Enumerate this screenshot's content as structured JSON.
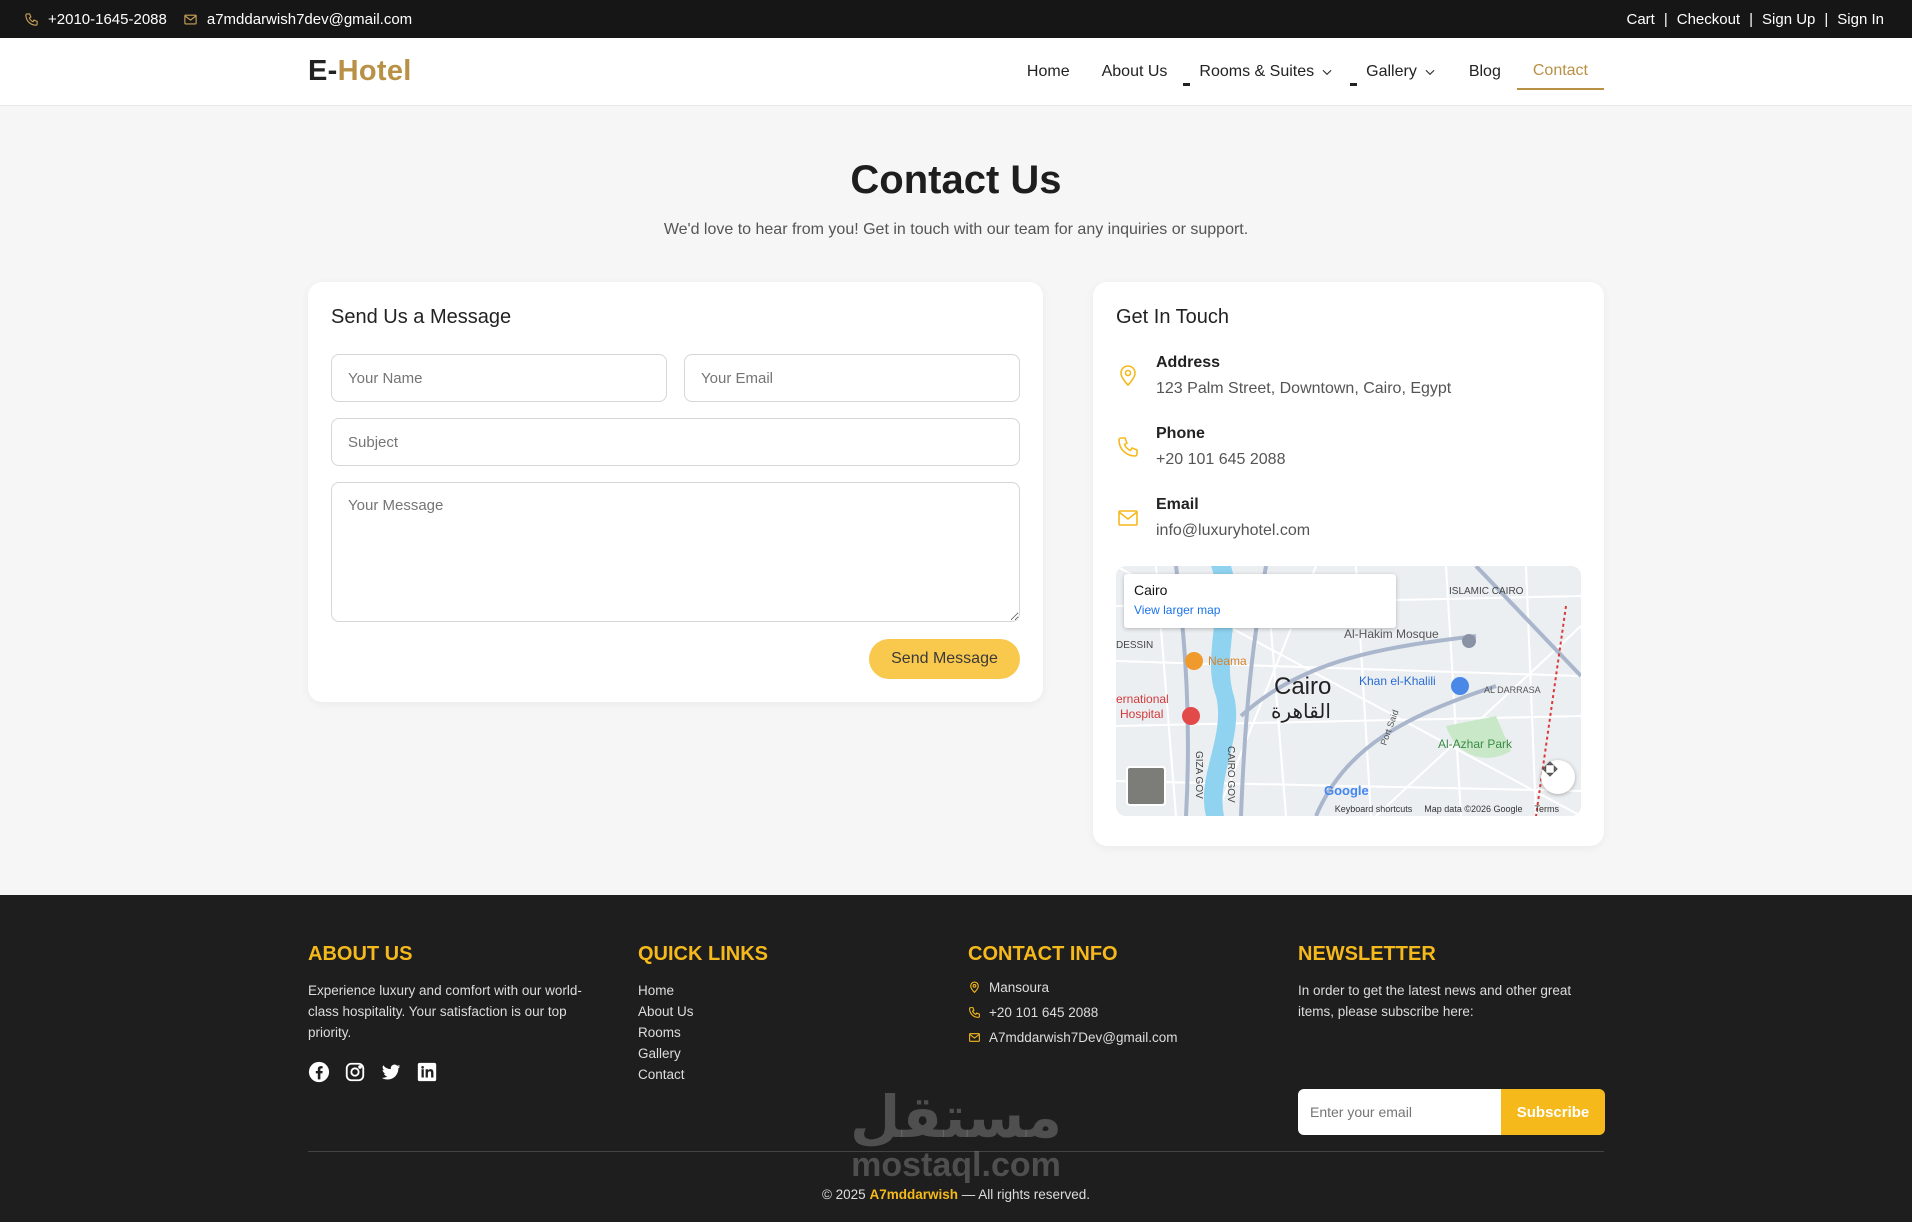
{
  "topbar": {
    "phone": "+2010-1645-2088",
    "email": "a7mddarwish7dev@gmail.com",
    "links": [
      "Cart",
      "Checkout",
      "Sign Up",
      "Sign In"
    ],
    "separator": "|"
  },
  "brand": {
    "prefix": "E-",
    "name": "Hotel",
    "accent_color": "#b89046"
  },
  "nav": {
    "home": "Home",
    "about": "About Us",
    "rooms": "Rooms & Suites",
    "gallery": "Gallery",
    "blog": "Blog",
    "contact": "Contact",
    "active": "Contact"
  },
  "hero": {
    "title": "Contact Us",
    "subtitle": "We'd love to hear from you! Get in touch with our team for any inquiries or support."
  },
  "form": {
    "title": "Send Us a Message",
    "name_placeholder": "Your Name",
    "email_placeholder": "Your Email",
    "subject_placeholder": "Subject",
    "message_placeholder": "Your Message",
    "submit_label": "Send Message",
    "button_color": "#f9c94e"
  },
  "contact": {
    "title": "Get In Touch",
    "address_label": "Address",
    "address_value": "123 Palm Street, Downtown, Cairo, Egypt",
    "phone_label": "Phone",
    "phone_value": "+20 101 645 2088",
    "email_label": "Email",
    "email_value": "info@luxuryhotel.com",
    "icon_color": "#f6b91c"
  },
  "map": {
    "popup_title": "Cairo",
    "popup_link": "View larger map",
    "city_label": "Cairo",
    "city_label_ar": "القاهرة",
    "places": [
      "ISLAMIC CAIRO",
      "Al-Hakim Mosque",
      "Khan el-Khalili",
      "AL DARRASA",
      "Al-Azhar Park",
      "Neama",
      "ernational",
      "Hospital",
      "DESSIN",
      "GIZA GOV",
      "CAIRO GOV",
      "Port Said"
    ],
    "logo": "Google",
    "attribution": [
      "Keyboard shortcuts",
      "Map data ©2026 Google",
      "Terms"
    ]
  },
  "footer": {
    "about_title": "ABOUT US",
    "about_text": "Experience luxury and comfort with our world-class hospitality. Your satisfaction is our top priority.",
    "links_title": "QUICK LINKS",
    "links": [
      "Home",
      "About Us",
      "Rooms",
      "Gallery",
      "Contact"
    ],
    "contact_title": "CONTACT INFO",
    "contact_location": "Mansoura",
    "contact_phone": "+20 101 645 2088",
    "contact_email": "A7mddarwish7Dev@gmail.com",
    "newsletter_title": "NEWSLETTER",
    "newsletter_text": "In order to get the latest news and other great items, please subscribe here:",
    "newsletter_placeholder": "Enter your email",
    "subscribe_label": "Subscribe",
    "copyright_prefix": "© 2025",
    "copyright_name": "A7mddarwish",
    "copyright_suffix": "— All rights reserved.",
    "accent_color": "#f6b91c",
    "socials": [
      "facebook-icon",
      "instagram-icon",
      "twitter-icon",
      "linkedin-icon"
    ]
  },
  "watermark": {
    "arabic": "مستقل",
    "latin": "mostaql.com"
  }
}
